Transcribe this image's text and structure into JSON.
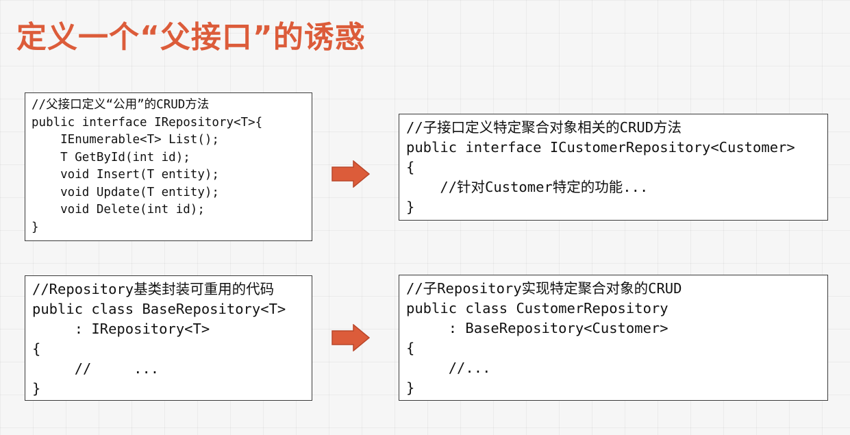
{
  "slide": {
    "title": "定义一个“父接口”的诱惑",
    "accent_color": "#dc5c3a",
    "arrow_icon": "right-arrow-icon"
  },
  "boxes": {
    "parent_interface": {
      "lines": [
        "//父接口定义“公用”的CRUD方法",
        "public interface IRepository<T>{",
        "    IEnumerable<T> List();",
        "    T GetById(int id);",
        "    void Insert(T entity);",
        "    void Update(T entity);",
        "    void Delete(int id);",
        "}"
      ]
    },
    "child_interface": {
      "lines": [
        "//子接口定义特定聚合对象相关的CRUD方法",
        "public interface ICustomerRepository<Customer>",
        "{",
        "    //针对Customer特定的功能...",
        "}"
      ]
    },
    "base_class": {
      "lines": [
        "//Repository基类封装可重用的代码",
        "public class BaseRepository<T>",
        "     : IRepository<T>",
        "{",
        "     //     ...",
        "}"
      ]
    },
    "child_class": {
      "lines": [
        "//子Repository实现特定聚合对象的CRUD",
        "public class CustomerRepository",
        "     : BaseRepository<Customer>",
        "{",
        "     //...",
        "}"
      ]
    }
  }
}
